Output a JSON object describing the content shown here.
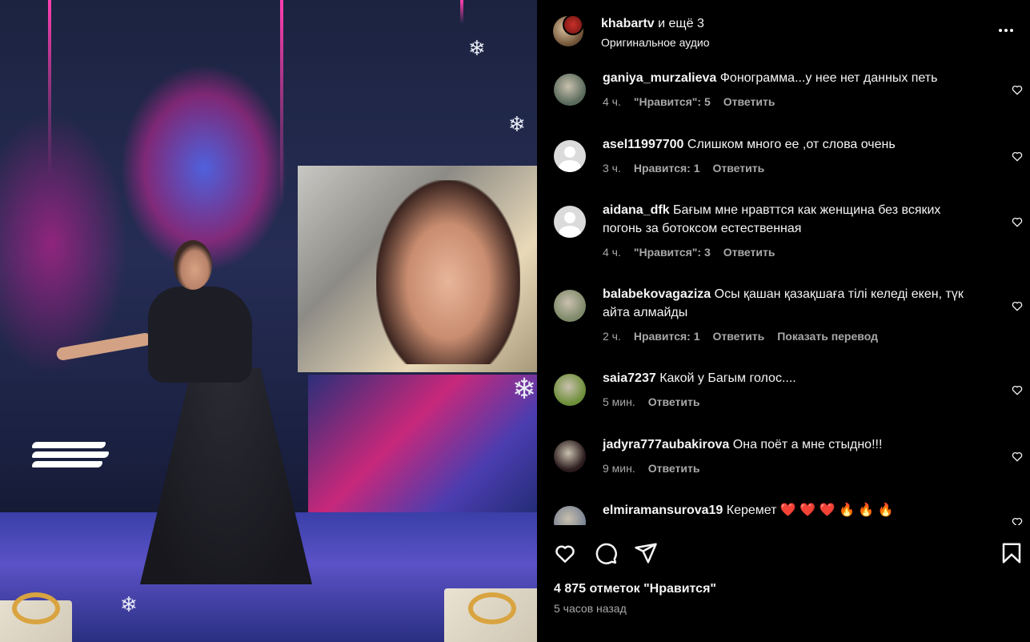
{
  "post": {
    "owner": "khabartv",
    "collab_suffix": " и ещё 3",
    "audio": "Оригинальное аудио",
    "likes": "4 875 отметок \"Нравится\"",
    "time_ago": "5 часов назад"
  },
  "comments": [
    {
      "user": "ganiya_murzalieva",
      "text": "Фонограмма...у нее нет данных петь",
      "time": "4 ч.",
      "likes": "\"Нравится\": 5",
      "reply": "Ответить",
      "translate": "",
      "avatar": "photo"
    },
    {
      "user": "asel11997700",
      "text": "Слишком много ее ,от слова очень",
      "time": "3 ч.",
      "likes": "Нравится: 1",
      "reply": "Ответить",
      "translate": "",
      "avatar": "default"
    },
    {
      "user": "aidana_dfk",
      "text": "Бағым мне нравттся как женщина без всяких погонь за ботоксом естественная",
      "time": "4 ч.",
      "likes": "\"Нравится\": 3",
      "reply": "Ответить",
      "translate": "",
      "avatar": "default"
    },
    {
      "user": "balabekovagaziza",
      "text": "Осы қашан қазақшаға тілі келеді екен, түк айта алмайды",
      "time": "2 ч.",
      "likes": "Нравится: 1",
      "reply": "Ответить",
      "translate": "Показать перевод",
      "avatar": "photo"
    },
    {
      "user": "saia7237",
      "text": "Какой у Багым голос....",
      "time": "5 мин.",
      "likes": "",
      "reply": "Ответить",
      "translate": "",
      "avatar": "photo"
    },
    {
      "user": "jadyra777aubakirova",
      "text": "Она поёт а мне стыдно!!!",
      "time": "9 мин.",
      "likes": "",
      "reply": "Ответить",
      "translate": "",
      "avatar": "photo"
    },
    {
      "user": "elmiramansurova19",
      "text": "Керемет ❤️ ❤️ ❤️ 🔥 🔥 🔥",
      "time": "",
      "likes": "",
      "reply": "",
      "translate": "",
      "avatar": "photo"
    }
  ],
  "icons": {
    "like": "heart-icon",
    "comment": "comment-icon",
    "share": "share-icon",
    "save": "bookmark-icon",
    "more": "more-icon"
  },
  "colors": {
    "background": "#000000",
    "text": "#f5f5f5",
    "secondary_text": "#a8a8a8"
  }
}
